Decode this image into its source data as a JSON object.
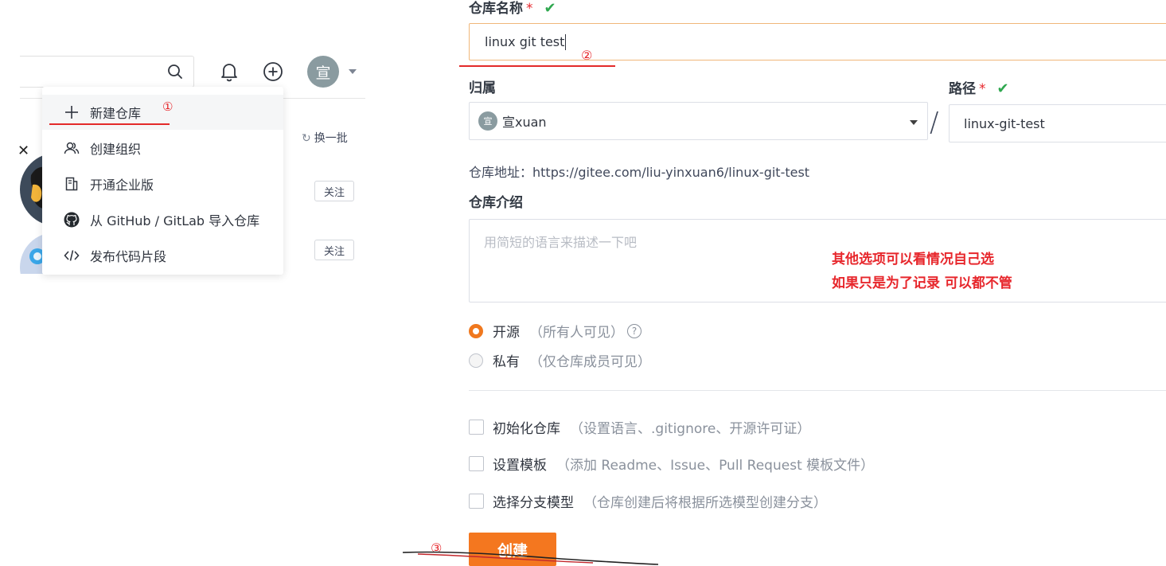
{
  "left": {
    "dropdown": {
      "items": [
        {
          "label": "新建仓库",
          "icon": "plus-icon"
        },
        {
          "label": "创建组织",
          "icon": "users-icon"
        },
        {
          "label": "开通企业版",
          "icon": "building-icon"
        },
        {
          "label": "从 GitHub / GitLab 导入仓库",
          "icon": "github-icon"
        },
        {
          "label": "发布代码片段",
          "icon": "code-icon"
        }
      ]
    },
    "avatar_text": "宣",
    "swap_label": "换一批",
    "follow_label": "关注",
    "annotation_1": "①"
  },
  "form": {
    "repo_name_label": "仓库名称",
    "required_mark": "*",
    "check_mark": "✔",
    "repo_name_value": "linux git test",
    "annotation_2": "②",
    "owner_label": "归属",
    "owner_avatar": "宣",
    "owner_value": "宣xuan",
    "slash": "/",
    "path_label": "路径",
    "path_value": "linux-git-test",
    "address_label": "仓库地址：",
    "address_value": "https://gitee.com/liu-yinxuan6/linux-git-test",
    "intro_label": "仓库介绍",
    "intro_placeholder": "用简短的语言来描述一下吧",
    "note_line1": "其他选项可以看情况自己选",
    "note_line2": "如果只是为了记录 可以都不管",
    "visibility": [
      {
        "label": "开源",
        "hint": "（所有人可见）",
        "selected": true
      },
      {
        "label": "私有",
        "hint": "（仅仓库成员可见）",
        "selected": false
      }
    ],
    "help_glyph": "?",
    "options": [
      {
        "label": "初始化仓库",
        "hint": "（设置语言、.gitignore、开源许可证）",
        "checked": false
      },
      {
        "label": "设置模板",
        "hint": "（添加 Readme、Issue、Pull Request 模板文件）",
        "checked": false
      },
      {
        "label": "选择分支模型",
        "hint": "（仓库创建后将根据所选模型创建分支）",
        "checked": false
      }
    ],
    "create_label": "创建",
    "annotation_3": "③"
  },
  "colors": {
    "accent": "#f4771f",
    "annotation_red": "#e7272c",
    "ok_green": "#2fa84f"
  }
}
